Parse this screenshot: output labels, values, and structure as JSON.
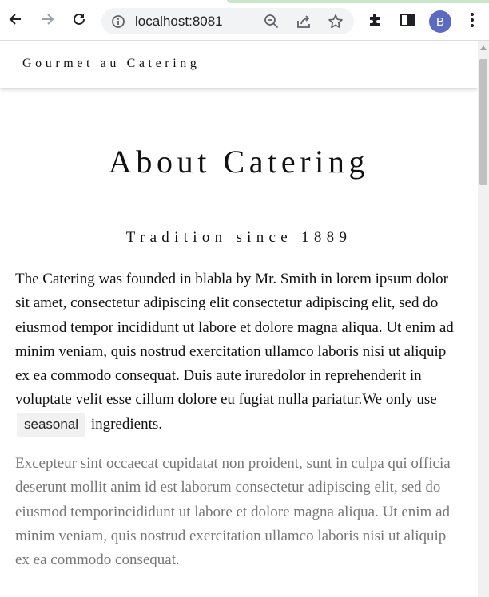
{
  "browser": {
    "url": "localhost:8081",
    "profile_initial": "B",
    "icons": [
      "back-icon",
      "forward-icon",
      "reload-icon",
      "site-info-icon",
      "zoom-icon",
      "share-icon",
      "bookmark-star-icon",
      "extensions-icon",
      "side-panel-icon",
      "menu-icon"
    ]
  },
  "page": {
    "brand": "Gourmet au Catering",
    "title": "About Catering",
    "subtitle": "Tradition since 1889",
    "paragraph1_before": "The Catering was founded in blabla by Mr. Smith in lorem ipsum dolor sit amet, consectetur adipiscing elit consectetur adipiscing elit, sed do eiusmod tempor incididunt ut labore et dolore magna aliqua. Ut enim ad minim veniam, quis nostrud exercitation ullamco laboris nisi ut aliquip ex ea commodo consequat. Duis aute iruredolor in reprehenderit in voluptate velit esse cillum dolore eu fugiat nulla pariatur.We only use",
    "paragraph1_tag": "seasonal",
    "paragraph1_after": "ingredients.",
    "paragraph2": "Excepteur sint occaecat cupidatat non proident, sunt in culpa qui officia deserunt mollit anim id est laborum consectetur adipiscing elit, sed do eiusmod temporincididunt ut labore et dolore magna aliqua. Ut enim ad minim veniam, quis nostrud exercitation ullamco laboris nisi ut aliquip ex ea commodo consequat."
  },
  "colors": {
    "text": "#111111",
    "muted_text": "#777777",
    "avatar_bg": "#5c6bc0",
    "tag_bg": "#f1f1f1"
  }
}
